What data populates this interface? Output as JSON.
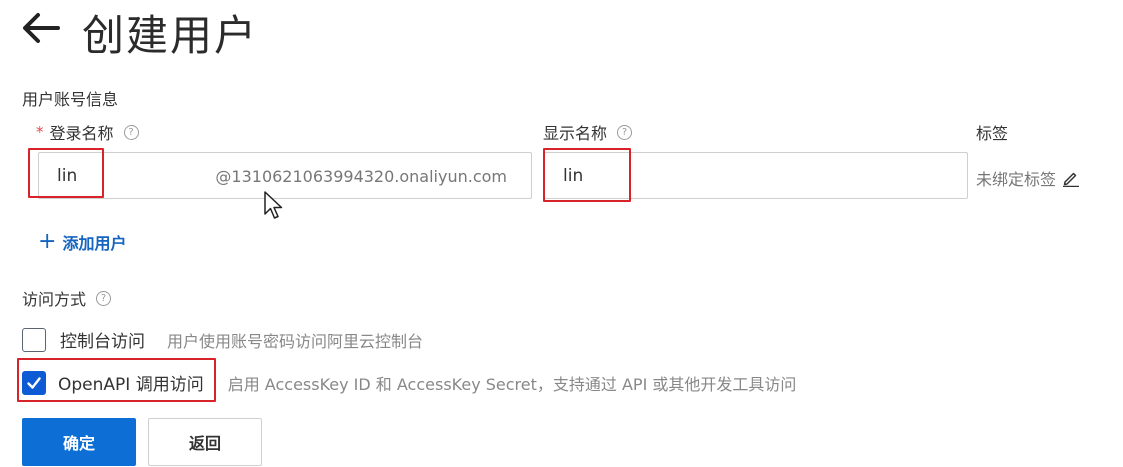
{
  "header": {
    "back_icon": "arrow-left-icon",
    "title": "创建用户"
  },
  "user_info": {
    "section_label": "用户账号信息",
    "login_name": {
      "required_mark": "*",
      "label": "登录名称",
      "help_icon": "question-circle-icon",
      "value": "lin",
      "domain_suffix": "@1310621063994320.onaliyun.com"
    },
    "display_name": {
      "label": "显示名称",
      "help_icon": "question-circle-icon",
      "value": "lin"
    },
    "tags": {
      "label": "标签",
      "value": "未绑定标签",
      "edit_icon": "pencil-icon"
    },
    "add_user": {
      "icon": "plus-icon",
      "label": "添加用户"
    }
  },
  "access": {
    "section_label": "访问方式",
    "help_icon": "question-circle-icon",
    "options": [
      {
        "label": "控制台访问",
        "description": "用户使用账号密码访问阿里云控制台",
        "checked": false
      },
      {
        "label": "OpenAPI 调用访问",
        "description": "启用 AccessKey ID 和 AccessKey Secret，支持通过 API 或其他开发工具访问",
        "checked": true
      }
    ]
  },
  "actions": {
    "confirm_label": "确定",
    "back_label": "返回"
  },
  "colors": {
    "primary": "#0d6ed6",
    "checkbox_checked": "#0d5bd4",
    "link": "#1565c0",
    "annotation_red": "#d8232a"
  }
}
